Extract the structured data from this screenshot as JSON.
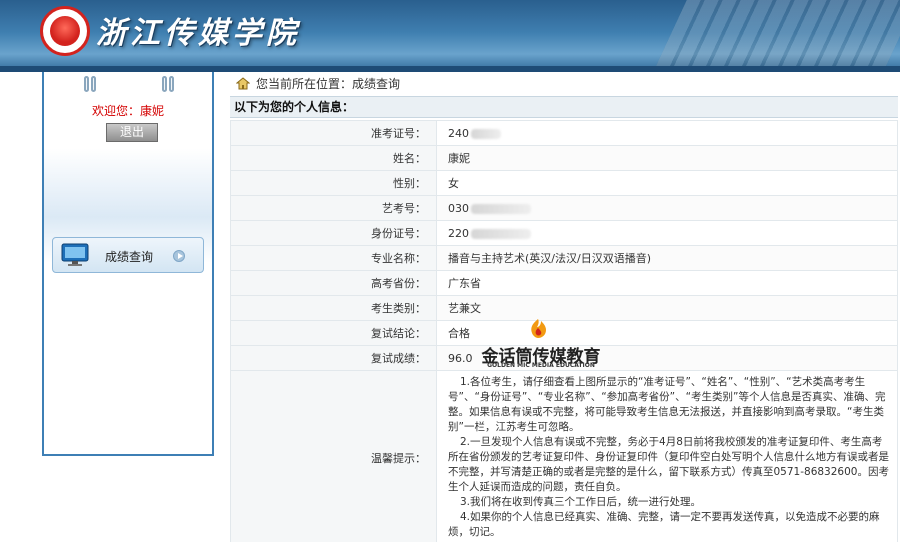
{
  "header": {
    "school_name": "浙江传媒学院"
  },
  "sidebar": {
    "welcome": "欢迎您：康妮",
    "logout_label": "退出",
    "menu": [
      {
        "label": "成绩查询",
        "icon": "monitor-icon"
      }
    ]
  },
  "breadcrumb": {
    "text": "您当前所在位置：成绩查询",
    "icon": "home-icon"
  },
  "section_title": "以下为您的个人信息：",
  "info": {
    "rows": [
      {
        "label": "准考证号：",
        "value": "240"
      },
      {
        "label": "姓名：",
        "value": "康妮"
      },
      {
        "label": "性别：",
        "value": "女"
      },
      {
        "label": "艺考号：",
        "value": "030"
      },
      {
        "label": "身份证号：",
        "value": "220"
      },
      {
        "label": "专业名称：",
        "value": "播音与主持艺术(英汉/法汉/日汉双语播音)"
      },
      {
        "label": "高考省份：",
        "value": "广东省"
      },
      {
        "label": "考生类别：",
        "value": "艺兼文"
      },
      {
        "label": "复试结论：",
        "value": "合格"
      },
      {
        "label": "复试成绩：",
        "value": "96.0"
      }
    ],
    "notes_label": "温馨提示：",
    "notes": [
      "1.各位考生，请仔细查看上图所显示的“准考证号”、“姓名”、“性别”、“艺术类高考考生号”、“身份证号”、“专业名称”、“参加高考省份”、“考生类别”等个人信息是否真实、准确、完整。如果信息有误或不完整，将可能导致考生信息无法报送，并直接影响到高考录取。“考生类别”一栏，江苏考生可忽略。",
      "2.一旦发现个人信息有误或不完整，务必于4月8日前将我校颁发的准考证复印件、考生高考所在省份颁发的艺考证复印件、身份证复印件（复印件空白处写明个人信息什么地方有误或者是不完整，并写清楚正确的或者是完整的是什么，留下联系方式）传真至0571-86832600。因考生个人延误而造成的问题，责任自负。",
      "3.我们将在收到传真三个工作日后，统一进行处理。",
      "4.如果你的个人信息已经真实、准确、完整，请一定不要再发送传真，以免造成不必要的麻烦，切记。"
    ]
  },
  "watermark": {
    "cn": "金话筒传媒教育",
    "en": "GOLDEN MIC MEDIA EDUCATION"
  },
  "colors": {
    "header_blue": "#3f7fb0",
    "sidebar_border": "#3e7fb5",
    "welcome_red": "#d40000"
  }
}
